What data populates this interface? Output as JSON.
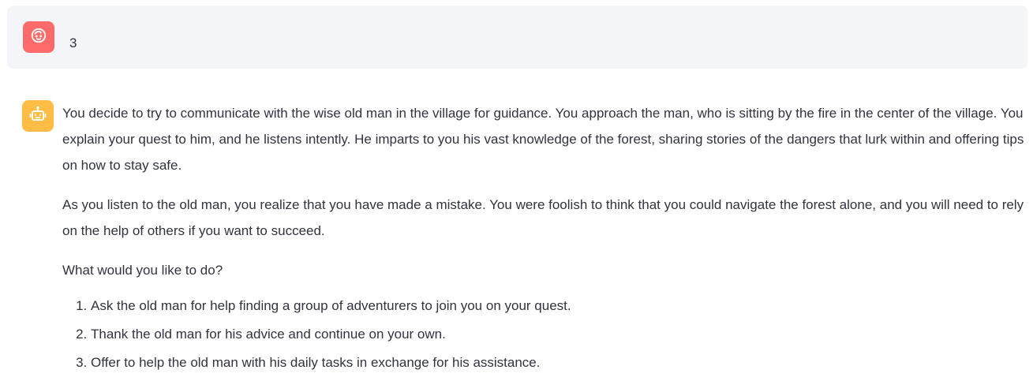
{
  "user_message": {
    "avatar_icon": "user-face-icon",
    "avatar_color": "#ff6b6b",
    "text": "3"
  },
  "assistant_message": {
    "avatar_icon": "robot-icon",
    "avatar_color": "#ffbd45",
    "paragraphs": [
      "You decide to try to communicate with the wise old man in the village for guidance. You approach the man, who is sitting by the fire in the center of the village. You explain your quest to him, and he listens intently. He imparts to you his vast knowledge of the forest, sharing stories of the dangers that lurk within and offering tips on how to stay safe.",
      "As you listen to the old man, you realize that you have made a mistake. You were foolish to think that you could navigate the forest alone, and you will need to rely on the help of others if you want to succeed.",
      "What would you like to do?"
    ],
    "options": [
      "Ask the old man for help finding a group of adventurers to join you on your quest.",
      "Thank the old man for his advice and continue on your own.",
      "Offer to help the old man with his daily tasks in exchange for his assistance."
    ]
  }
}
